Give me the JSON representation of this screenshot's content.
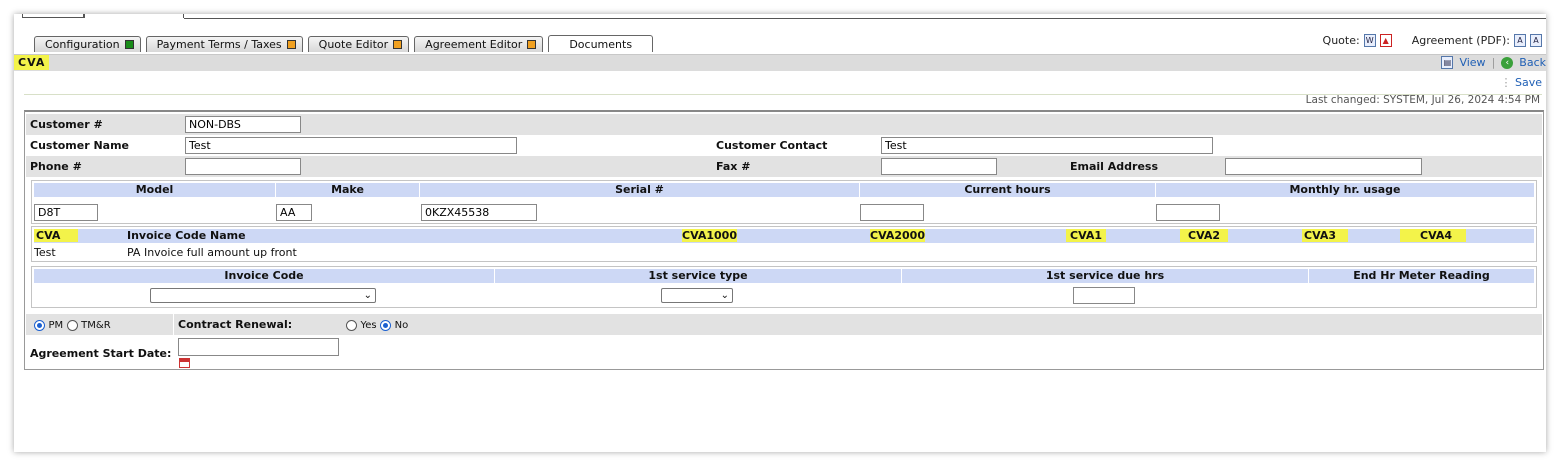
{
  "tabs": [
    {
      "label": "Configuration",
      "status_color": "#1a8c1a"
    },
    {
      "label": "Payment Terms / Taxes",
      "status_color": "#f0a020"
    },
    {
      "label": "Quote Editor",
      "status_color": "#f0a020"
    },
    {
      "label": "Agreement Editor",
      "status_color": "#f0a020"
    },
    {
      "label": "Documents",
      "active": true
    }
  ],
  "header_right": {
    "quote_label": "Quote:",
    "agreement_label": "Agreement (PDF):"
  },
  "title": "CVA",
  "actions": {
    "view": "View",
    "back": "Back",
    "save": "Save"
  },
  "last_changed": "Last changed: SYSTEM, Jul 26, 2024 4:54 PM",
  "customer": {
    "number_label": "Customer #",
    "number_value": "NON-DBS",
    "name_label": "Customer Name",
    "name_value": "Test",
    "contact_label": "Customer Contact",
    "contact_value": "Test",
    "phone_label": "Phone #",
    "phone_value": "",
    "fax_label": "Fax #",
    "fax_value": "",
    "email_label": "Email Address",
    "email_value": ""
  },
  "machine": {
    "headers": [
      "Model",
      "Make",
      "Serial #",
      "Current hours",
      "Monthly hr. usage"
    ],
    "values": [
      "D8T",
      "AA",
      "0KZX45538",
      "",
      ""
    ]
  },
  "invoice_table": {
    "headers": [
      "CVA",
      "Invoice Code Name",
      "CVA1000",
      "CVA2000",
      "CVA1",
      "CVA2",
      "CVA3",
      "CVA4"
    ],
    "row": [
      "Test",
      "PA Invoice full amount up front"
    ]
  },
  "service": {
    "headers": [
      "Invoice Code",
      "1st service type",
      "1st service due hrs",
      "End Hr Meter Reading"
    ]
  },
  "agreement": {
    "pm_label": "PM",
    "tmr_label": "TM&R",
    "renewal_label": "Contract Renewal:",
    "yes_label": "Yes",
    "no_label": "No",
    "start_label": "Agreement Start Date:",
    "start_value": ""
  },
  "colors": {
    "highlight": "#f3f34a",
    "header_blue": "#cdd8f5",
    "grey_row": "#e2e2e2",
    "link": "#1f5fb5"
  }
}
